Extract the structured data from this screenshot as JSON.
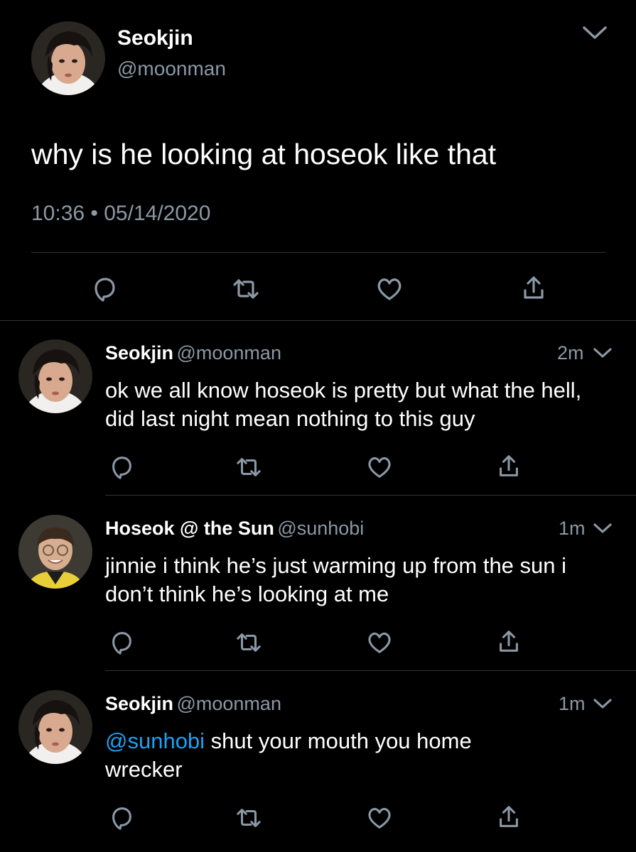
{
  "main_tweet": {
    "display_name": "Seokjin",
    "handle": "@moonman",
    "text": "why is he looking at hoseok like that",
    "timestamp": "10:36 • 05/14/2020"
  },
  "replies": [
    {
      "display_name": "Seokjin",
      "handle": "@moonman",
      "time": "2m",
      "text": "ok we all know hoseok is pretty but what the hell, did last night mean nothing to this guy"
    },
    {
      "display_name": "Hoseok @ the Sun",
      "handle": "@sunhobi",
      "time": "1m",
      "text": "jinnie i think he’s just warming up from the sun i don’t think he’s looking at me"
    },
    {
      "display_name": "Seokjin",
      "handle": "@moonman",
      "time": "1m",
      "mention": "@sunhobi",
      "text": " shut your mouth you home wrecker"
    }
  ],
  "icons": {
    "reply": "reply-icon",
    "retweet": "retweet-icon",
    "like": "heart-icon",
    "share": "share-icon",
    "menu": "chevron-down-icon"
  },
  "colors": {
    "background": "#000000",
    "text": "#ffffff",
    "muted": "#8b98a5",
    "link": "#1da1f2",
    "divider": "#2f3336"
  }
}
